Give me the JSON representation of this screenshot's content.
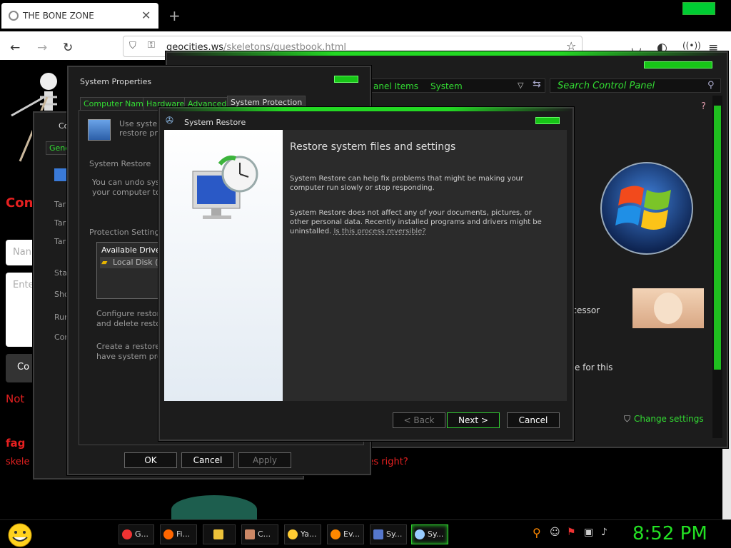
{
  "browser": {
    "tab_title": "THE BONE ZONE",
    "url_host": "geocities.ws",
    "url_path": "/skeletons/guestbook.html"
  },
  "page": {
    "heading_fragment": "Con",
    "name_placeholder_fragment": "Nan",
    "enter_placeholder_fragment": "Ente",
    "submit_fragment": "Co",
    "not_fragment": "Not",
    "bottom_label": "fag",
    "bottom_prefix": "skele",
    "bottom_line": "igger your bones right?"
  },
  "control_panel": {
    "breadcrumb_1": "anel Items",
    "breadcrumb_2": "System",
    "search_placeholder": "Search Control Panel",
    "processor_fragment": "ocessor",
    "available_fragment": "ble for this",
    "change_settings": "Change settings"
  },
  "computer_name_window": {
    "title_fragment": "Co",
    "tab_fragment": "Gene",
    "labels": [
      "Tar",
      "Tar",
      "Tar",
      "Star",
      "Sho",
      "Run",
      "Con"
    ]
  },
  "system_properties": {
    "title": "System Properties",
    "tabs": [
      "Computer Name",
      "Hardware",
      "Advanced",
      "System Protection"
    ],
    "intro_line1": "Use system",
    "intro_line2": "restore prev",
    "section_restore": "System Restore",
    "undo_line1": "You can undo syste",
    "undo_line2": "your computer to a p",
    "section_protection": "Protection Settings",
    "drives_header": "Available Drives",
    "drive_item": "Local Disk (C",
    "configure_line1": "Configure restore s",
    "configure_line2": "and delete restore",
    "create_line1": "Create a restore po",
    "create_line2": "have system prote",
    "ok": "OK",
    "cancel": "Cancel",
    "apply": "Apply"
  },
  "system_restore": {
    "title": "System Restore",
    "heading": "Restore system files and settings",
    "para1": "System Restore can help fix problems that might be making your computer run slowly or stop responding.",
    "para2_line1": "System Restore does not affect any of your documents, pictures, or",
    "para2_line2": "other personal data. Recently installed programs and drivers might be",
    "para2_line3": "uninstalled.",
    "link": "Is this process reversible?",
    "back": "< Back",
    "next": "Next >",
    "cancel": "Cancel"
  },
  "taskbar": {
    "items": [
      "G...",
      "Fi...",
      "",
      "C...",
      "Ya...",
      "Ev...",
      "Sy...",
      "Sy..."
    ],
    "clock": "8:52 PM"
  },
  "colors": {
    "accent_green": "#23d823",
    "page_red": "#e52020"
  }
}
